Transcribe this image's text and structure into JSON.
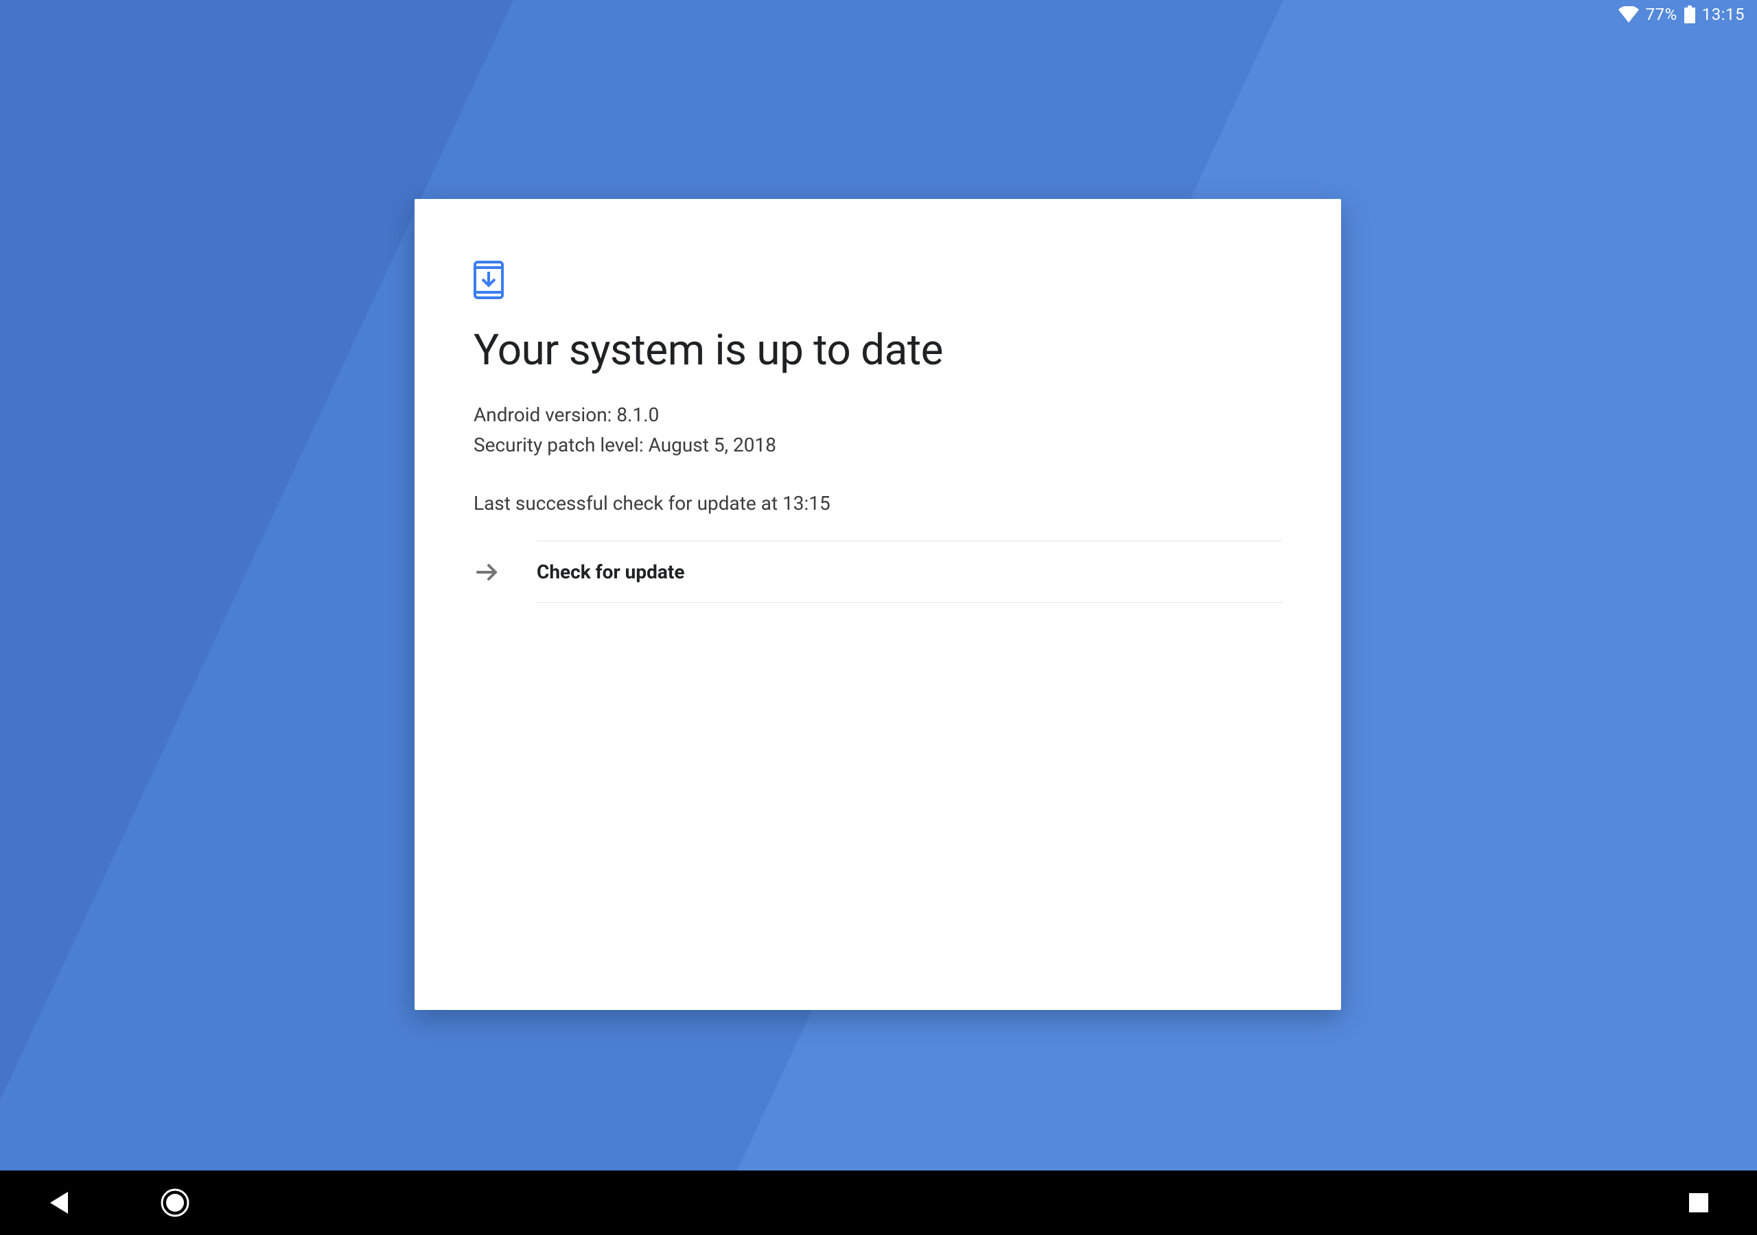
{
  "status_bar": {
    "battery_pct": "77%",
    "clock": "13:15"
  },
  "card": {
    "title": "Your system is up to date",
    "android_version_line": "Android version: 8.1.0",
    "security_patch_line": "Security patch level: August 5, 2018",
    "last_check_line": "Last successful check for update at 13:15",
    "check_update_label": "Check for update"
  },
  "colors": {
    "accent": "#3a7df0"
  }
}
